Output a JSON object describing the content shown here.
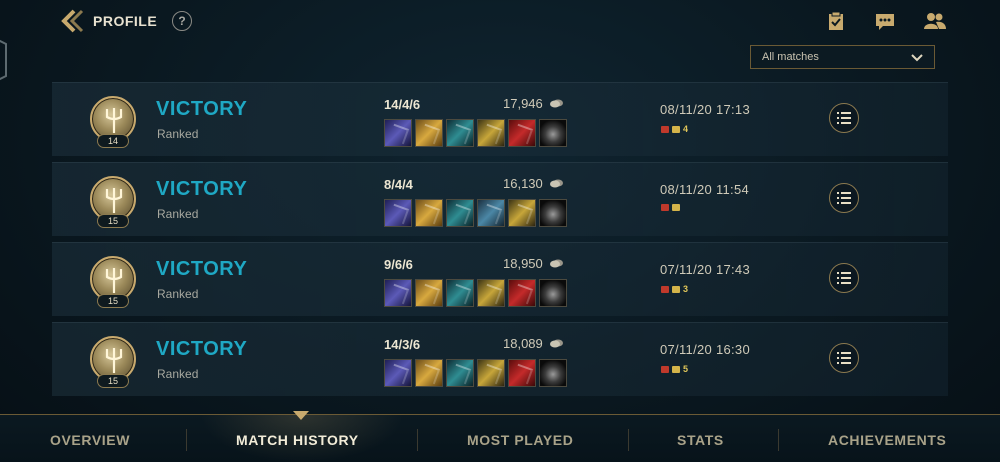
{
  "header": {
    "title": "PROFILE",
    "help_glyph": "?",
    "icons": [
      "clipboard-icon",
      "chat-icon",
      "friends-icon"
    ]
  },
  "filter": {
    "selected": "All matches"
  },
  "matches": [
    {
      "result": "VICTORY",
      "queue": "Ranked",
      "level": "14",
      "kda": "14/4/6",
      "gold": "17,946",
      "date": "08/11/20 17:13",
      "badge_count": "4",
      "items": [
        "purple",
        "gold-x",
        "teal",
        "yellow",
        "red",
        "ward"
      ]
    },
    {
      "result": "VICTORY",
      "queue": "Ranked",
      "level": "15",
      "kda": "8/4/4",
      "gold": "16,130",
      "date": "08/11/20 11:54",
      "badge_count": "",
      "items": [
        "purple",
        "gold-x",
        "teal",
        "steel",
        "yellow",
        "ward"
      ]
    },
    {
      "result": "VICTORY",
      "queue": "Ranked",
      "level": "15",
      "kda": "9/6/6",
      "gold": "18,950",
      "date": "07/11/20 17:43",
      "badge_count": "3",
      "items": [
        "purple",
        "gold-x",
        "teal",
        "yellow",
        "red",
        "ward"
      ]
    },
    {
      "result": "VICTORY",
      "queue": "Ranked",
      "level": "15",
      "kda": "14/3/6",
      "gold": "18,089",
      "date": "07/11/20 16:30",
      "badge_count": "5",
      "items": [
        "purple",
        "gold-x",
        "teal",
        "yellow",
        "red",
        "ward"
      ]
    }
  ],
  "nav": {
    "tabs": [
      "OVERVIEW",
      "MATCH HISTORY",
      "MOST PLAYED",
      "STATS",
      "ACHIEVEMENTS"
    ],
    "active": "MATCH HISTORY"
  },
  "colors": {
    "victory": "#1fa8c4",
    "gold_accent": "#c8aa6e",
    "background": "#0a1820"
  }
}
